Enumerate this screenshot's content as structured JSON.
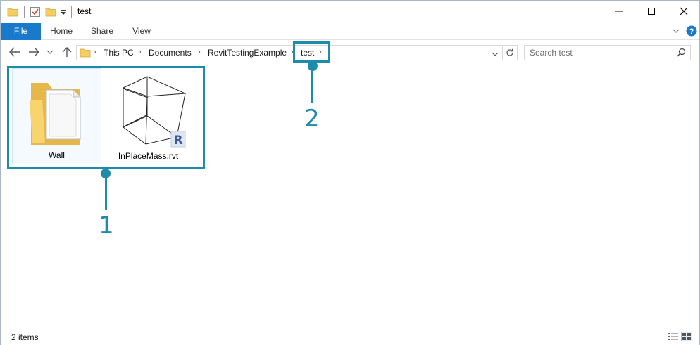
{
  "window": {
    "title": "test",
    "controls": {
      "minimize": "minimize-icon",
      "maximize": "maximize-icon",
      "close": "close-icon"
    }
  },
  "ribbon": {
    "tabs": [
      {
        "label": "File",
        "active": true,
        "color": "#1979ca"
      },
      {
        "label": "Home"
      },
      {
        "label": "Share"
      },
      {
        "label": "View"
      }
    ],
    "help_label": "?"
  },
  "address": {
    "crumbs": [
      "This PC",
      "Documents",
      "RevitTestingExample",
      "test"
    ]
  },
  "search": {
    "placeholder": "Search test"
  },
  "items": [
    {
      "name": "Wall",
      "icon": "folder-icon",
      "selected": true
    },
    {
      "name": "InPlaceMass.rvt",
      "icon": "revit-file-icon",
      "badge": "R"
    }
  ],
  "callouts": [
    {
      "label": "1",
      "color": "#1f8bab"
    },
    {
      "label": "2",
      "color": "#1f8bab"
    }
  ],
  "status": {
    "count_text": "2 items"
  }
}
